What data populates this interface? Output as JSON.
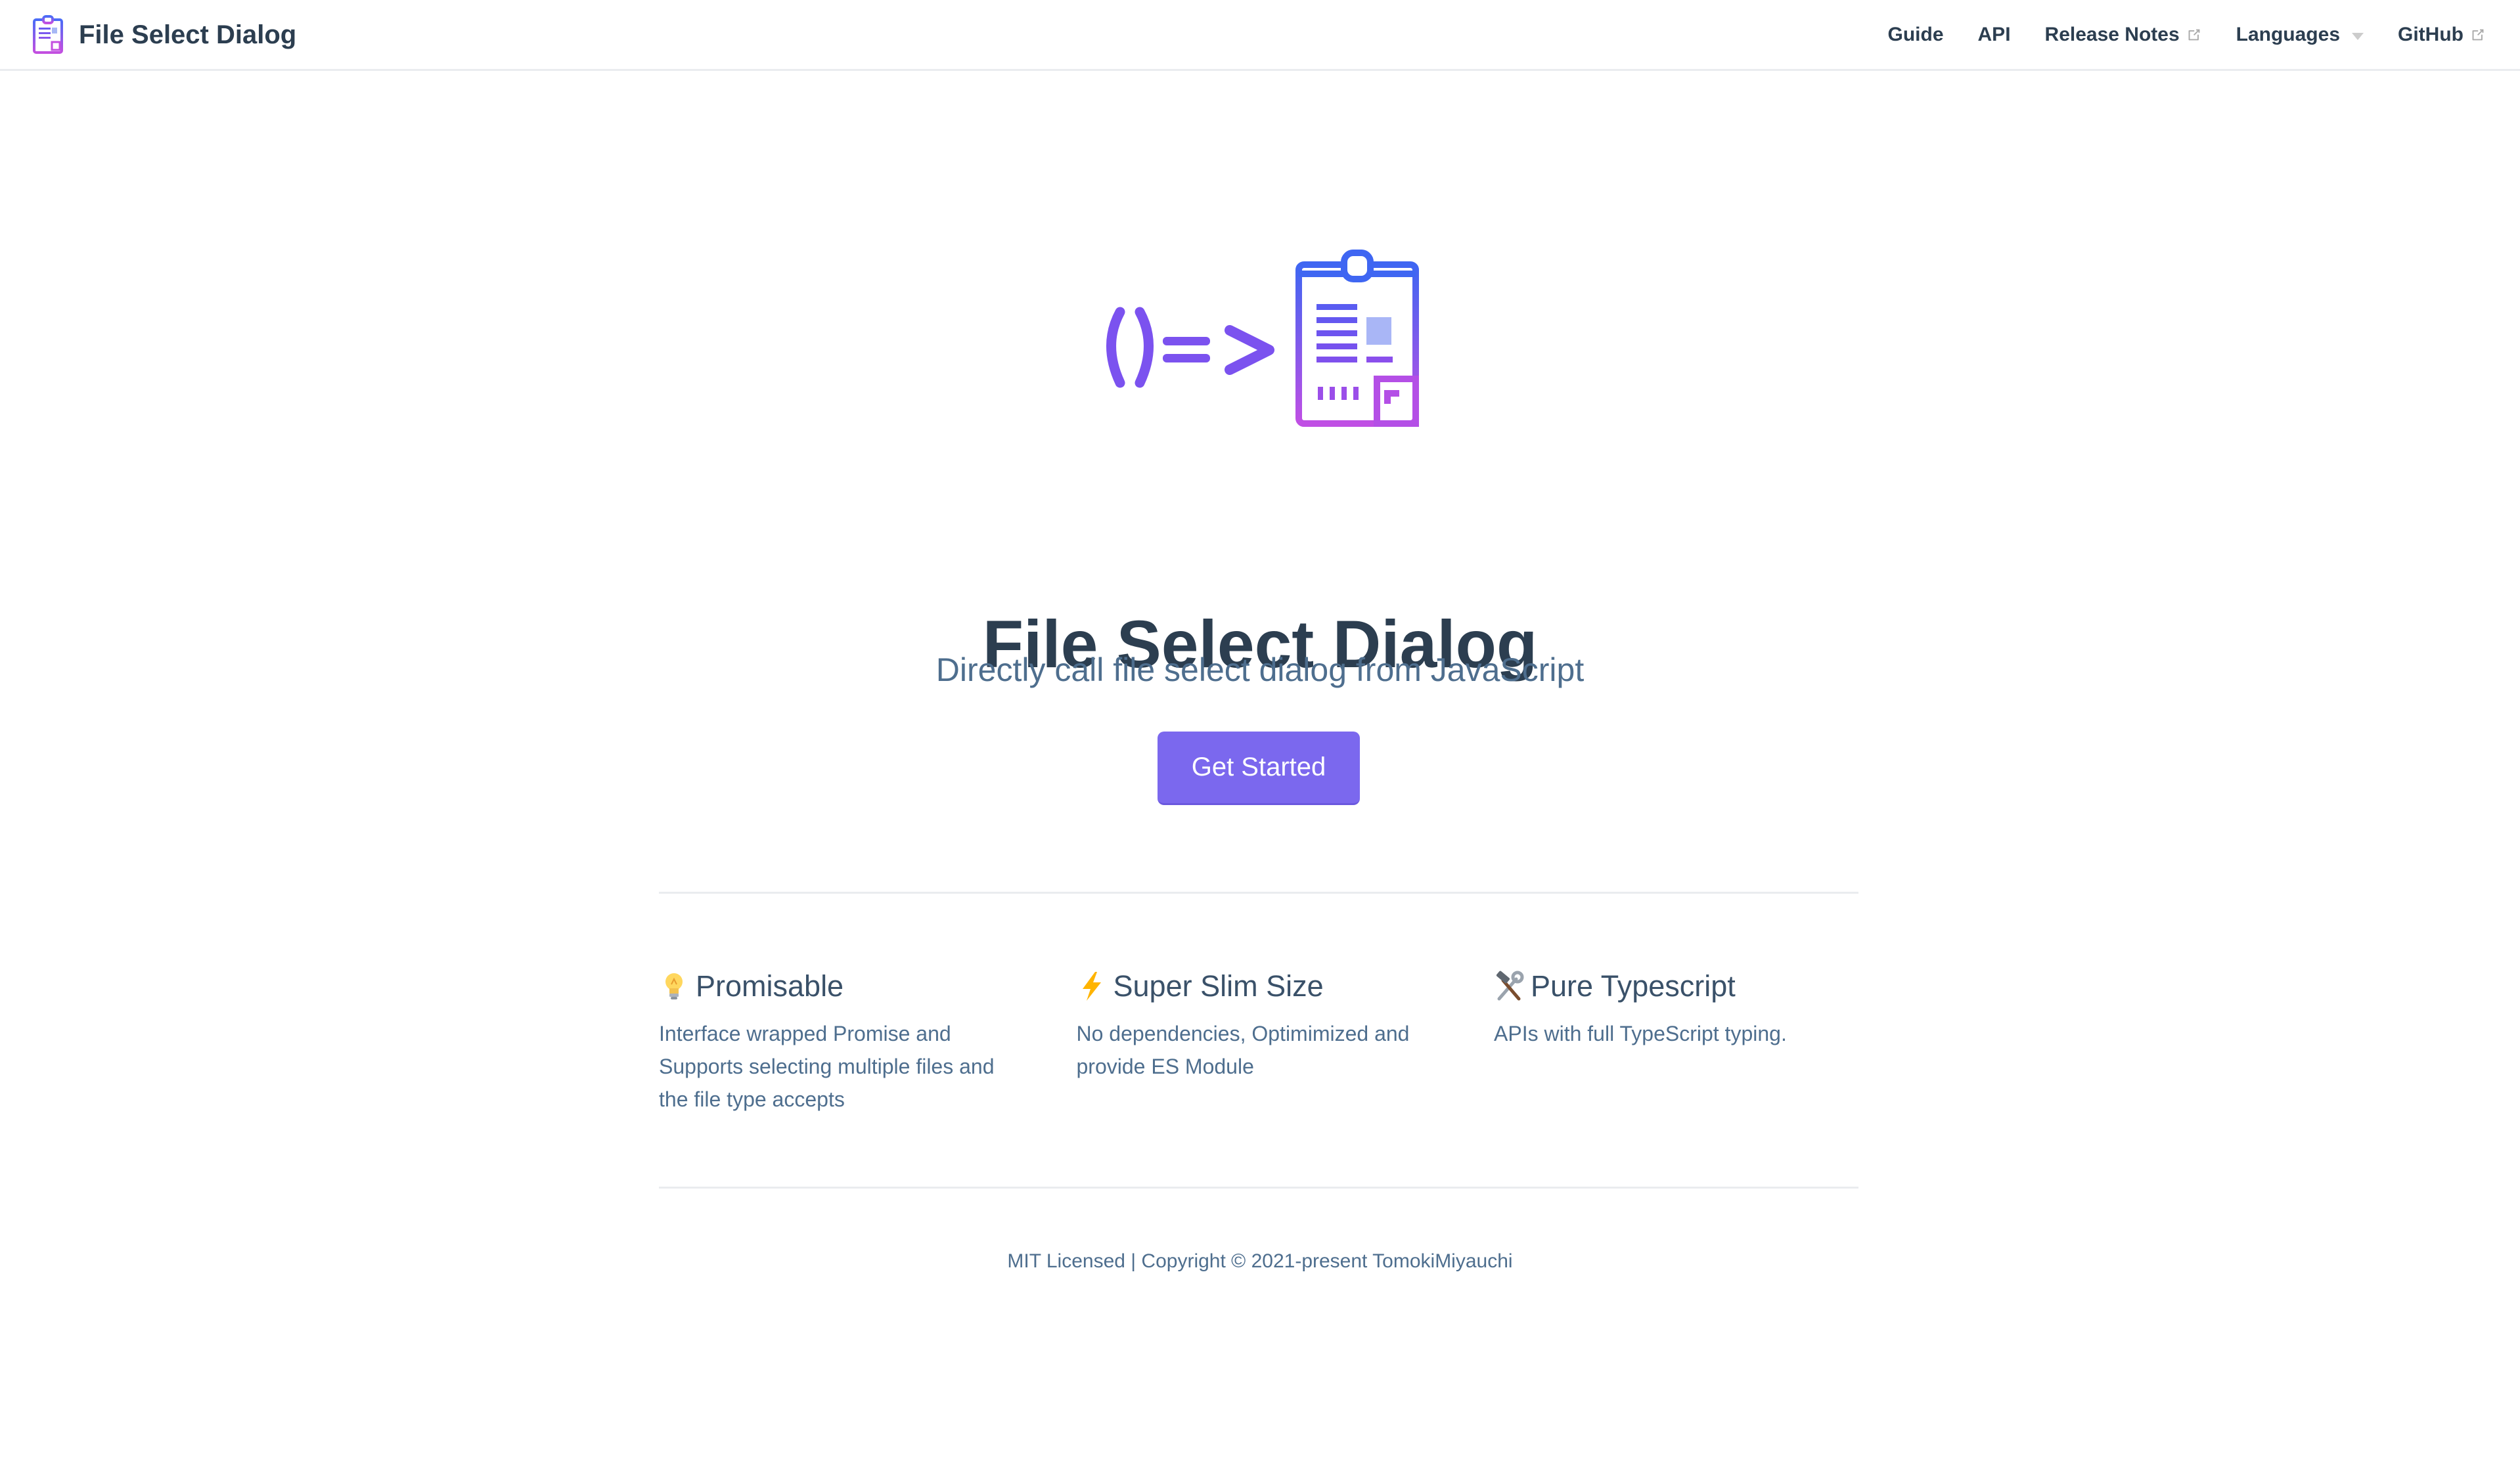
{
  "site": {
    "title": "File Select Dialog"
  },
  "nav": {
    "items": [
      {
        "label": "Guide",
        "external": false,
        "dropdown": false
      },
      {
        "label": "API",
        "external": false,
        "dropdown": false
      },
      {
        "label": "Release Notes",
        "external": true,
        "dropdown": false
      },
      {
        "label": "Languages",
        "external": false,
        "dropdown": true
      },
      {
        "label": "GitHub",
        "external": true,
        "dropdown": false
      }
    ]
  },
  "hero": {
    "logo_icon": "arrow-function-clipboard-icon",
    "title": "File Select Dialog",
    "description": "Directly call file select dialog from JavaScript",
    "action_label": "Get Started"
  },
  "features": [
    {
      "icon": "lightbulb-icon",
      "title": "Promisable",
      "details": "Interface wrapped Promise and Supports selecting multiple files and the file type accepts"
    },
    {
      "icon": "lightning-icon",
      "title": "Super Slim Size",
      "details": "No dependencies, Optimimized and provide ES Module"
    },
    {
      "icon": "hammer-wrench-icon",
      "title": "Pure Typescript",
      "details": "APIs with full TypeScript typing."
    }
  ],
  "footer": {
    "text": "MIT Licensed | Copyright © 2021-present TomokiMiyauchi"
  },
  "colors": {
    "accent": "#7b68ee",
    "text": "#2c3e50",
    "muted": "#4e6e8e",
    "border": "#eaecef"
  }
}
